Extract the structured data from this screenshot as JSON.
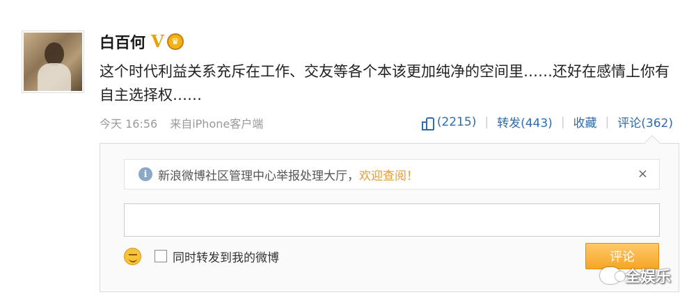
{
  "post": {
    "username": "白百何",
    "badge_v": "V",
    "crown_glyph": "♛",
    "text": "这个时代利益关系充斥在工作、交友等各个本该更加纯净的空间里……还好在感情上你有自主选择权……",
    "time": "今天 16:56",
    "source": "来自iPhone客户端"
  },
  "actions": {
    "like_count": "(2215)",
    "repost": "转发(443)",
    "favorite": "收藏",
    "comment": "评论(362)"
  },
  "comment_box": {
    "notice_text": "新浪微博社区管理中心举报处理大厅，",
    "notice_welcome": "欢迎查阅！",
    "info_glyph": "i",
    "close_glyph": "×",
    "input_value": "",
    "repost_label": "同时转发到我的微博",
    "submit_label": "评论"
  },
  "watermark": {
    "text": "全娱乐"
  },
  "colors": {
    "link_blue": "#2f6ba8",
    "accent_orange": "#f5a623",
    "welcome_orange": "#e49b2f"
  }
}
